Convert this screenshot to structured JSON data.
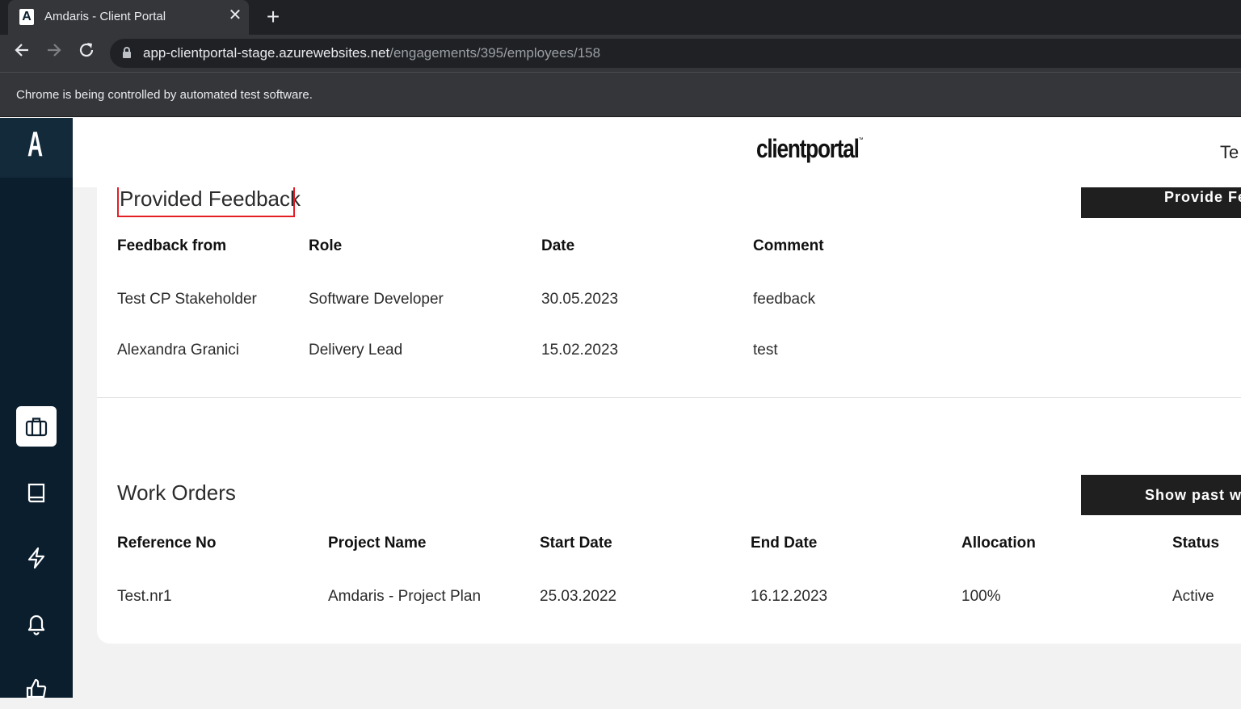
{
  "browser": {
    "tab_title": "Amdaris - Client Portal",
    "tab_favicon": "A",
    "url_host": "app-clientportal-stage.azurewebsites.net",
    "url_path": "/engagements/395/employees/158",
    "infobar": "Chrome is being controlled by automated test software."
  },
  "sidebar": {
    "logo": "A",
    "items": [
      {
        "icon": "briefcase-icon",
        "active": true
      },
      {
        "icon": "book-icon",
        "active": false
      },
      {
        "icon": "lightning-icon",
        "active": false
      },
      {
        "icon": "bell-icon",
        "active": false
      },
      {
        "icon": "thumbs-up-icon",
        "active": false
      }
    ]
  },
  "header": {
    "brand": "clientportal",
    "brand_tm": "™",
    "user": "Te"
  },
  "feedback": {
    "title": "Provided Feedback",
    "button": "Provide Fe",
    "columns": [
      "Feedback from",
      "Role",
      "Date",
      "Comment"
    ],
    "rows": [
      [
        "Test CP Stakeholder",
        "Software Developer",
        "30.05.2023",
        "feedback"
      ],
      [
        "Alexandra Granici",
        "Delivery Lead",
        "15.02.2023",
        "test"
      ]
    ]
  },
  "work_orders": {
    "title": "Work Orders",
    "button": "Show past w",
    "columns": [
      "Reference No",
      "Project Name",
      "Start Date",
      "End Date",
      "Allocation",
      "Status"
    ],
    "rows": [
      [
        "Test.nr1",
        "Amdaris - Project Plan",
        "25.03.2022",
        "16.12.2023",
        "100%",
        "Active"
      ]
    ]
  },
  "colors": {
    "sidebar_bg": "#0b1e2d",
    "highlight": "#e31e24",
    "button_bg": "#1f1f1f"
  }
}
